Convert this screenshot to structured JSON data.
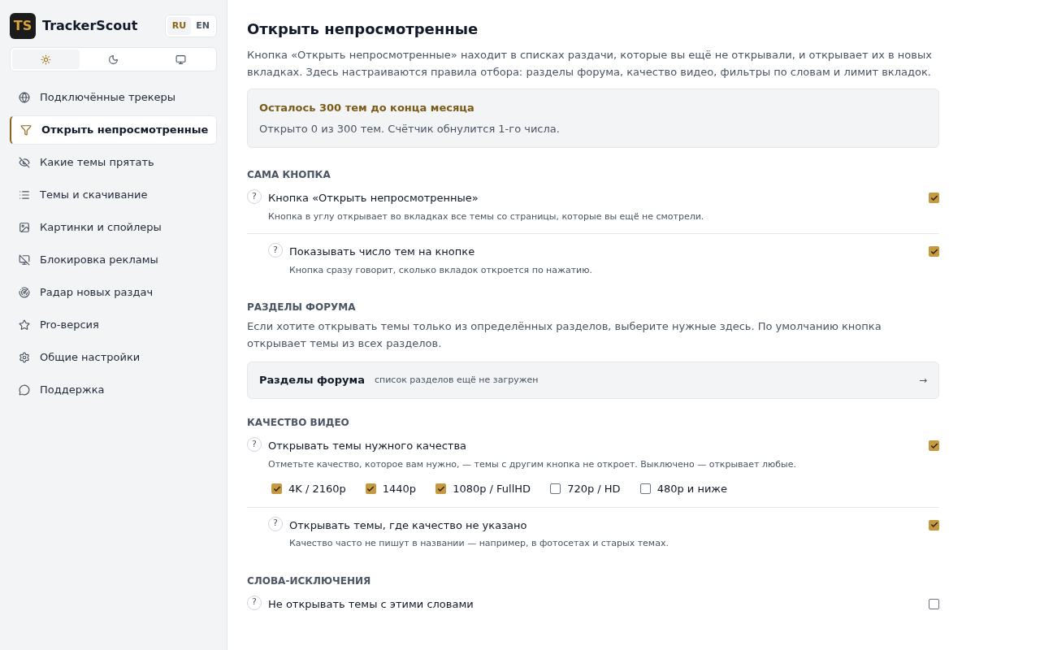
{
  "brand": {
    "logo": "TS",
    "name": "TrackerScout"
  },
  "languages": [
    {
      "label": "RU",
      "selected": true
    },
    {
      "label": "EN",
      "selected": false
    }
  ],
  "theme_modes": [
    {
      "kind": "light",
      "selected": true
    },
    {
      "kind": "dark",
      "selected": false
    },
    {
      "kind": "system",
      "selected": false
    }
  ],
  "sidebar": {
    "items": [
      {
        "label": "Подключённые трекеры",
        "selected": false
      },
      {
        "label": "Открыть непросмотренные",
        "selected": true
      },
      {
        "label": "Какие темы прятать",
        "selected": false
      },
      {
        "label": "Темы и скачивание",
        "selected": false
      },
      {
        "label": "Картинки и спойлеры",
        "selected": false
      },
      {
        "label": "Блокировка рекламы",
        "selected": false
      },
      {
        "label": "Радар новых раздач",
        "selected": false
      },
      {
        "label": "Pro-версия",
        "selected": false
      },
      {
        "label": "Общие настройки",
        "selected": false
      },
      {
        "label": "Поддержка",
        "selected": false
      }
    ]
  },
  "page": {
    "title": "Открыть непросмотренные",
    "description": "Кнопка «Открыть непросмотренные» находит в списках раздачи, которые вы ещё не открывали, и открывает их в новых вкладках. Здесь настраиваются правила отбора: разделы форума, качество видео, фильтры по словам и лимит вкладок."
  },
  "quota": {
    "title": "Осталось 300 тем до конца месяца",
    "text": "Открыто 0 из 300 тем. Счётчик обнулится 1-го числа."
  },
  "sections": [
    {
      "heading": "САМА КНОПКА",
      "items": [
        {
          "kind": "setting",
          "help": "?",
          "label": "Кнопка «Открыть непросмотренные»",
          "hint": "Кнопка в углу открывает во вкладках все темы со страницы, которые вы ещё не смотрели.",
          "checked": true,
          "children": [
            {
              "help": "?",
              "label": "Показывать число тем на кнопке",
              "hint": "Кнопка сразу говорит, сколько вкладок откроется по нажатию.",
              "checked": true
            }
          ]
        }
      ]
    },
    {
      "heading": "РАЗДЕЛЫ ФОРУМА",
      "description": "Если хотите открывать темы только из определённых разделов, выберите нужные здесь. По умолчанию кнопка открывает темы из всех разделов.",
      "items": [
        {
          "kind": "picker",
          "label": "Разделы форума",
          "value": "список разделов ещё не загружен",
          "arrow": "→"
        }
      ]
    },
    {
      "heading": "КАЧЕСТВО ВИДЕО",
      "items": [
        {
          "kind": "setting",
          "help": "?",
          "label": "Открывать темы нужного качества",
          "hint": "Отметьте качество, которое вам нужно, — темы с другим кнопка не откроет. Выключено — открывает любые.",
          "checked": true,
          "options": [
            {
              "label": "4K / 2160p",
              "checked": true
            },
            {
              "label": "1440p",
              "checked": true
            },
            {
              "label": "1080p / FullHD",
              "checked": true
            },
            {
              "label": "720p / HD",
              "checked": false
            },
            {
              "label": "480p и ниже",
              "checked": false
            }
          ],
          "children": [
            {
              "help": "?",
              "label": "Открывать темы, где качество не указано",
              "hint": "Качество часто не пишут в названии — например, в фотосетах и старых темах.",
              "checked": true
            }
          ]
        }
      ]
    },
    {
      "heading": "СЛОВА-ИСКЛЮЧЕНИЯ",
      "items": [
        {
          "kind": "setting",
          "help": "?",
          "label": "Не открывать темы с этими словами",
          "checked": false
        }
      ]
    }
  ]
}
